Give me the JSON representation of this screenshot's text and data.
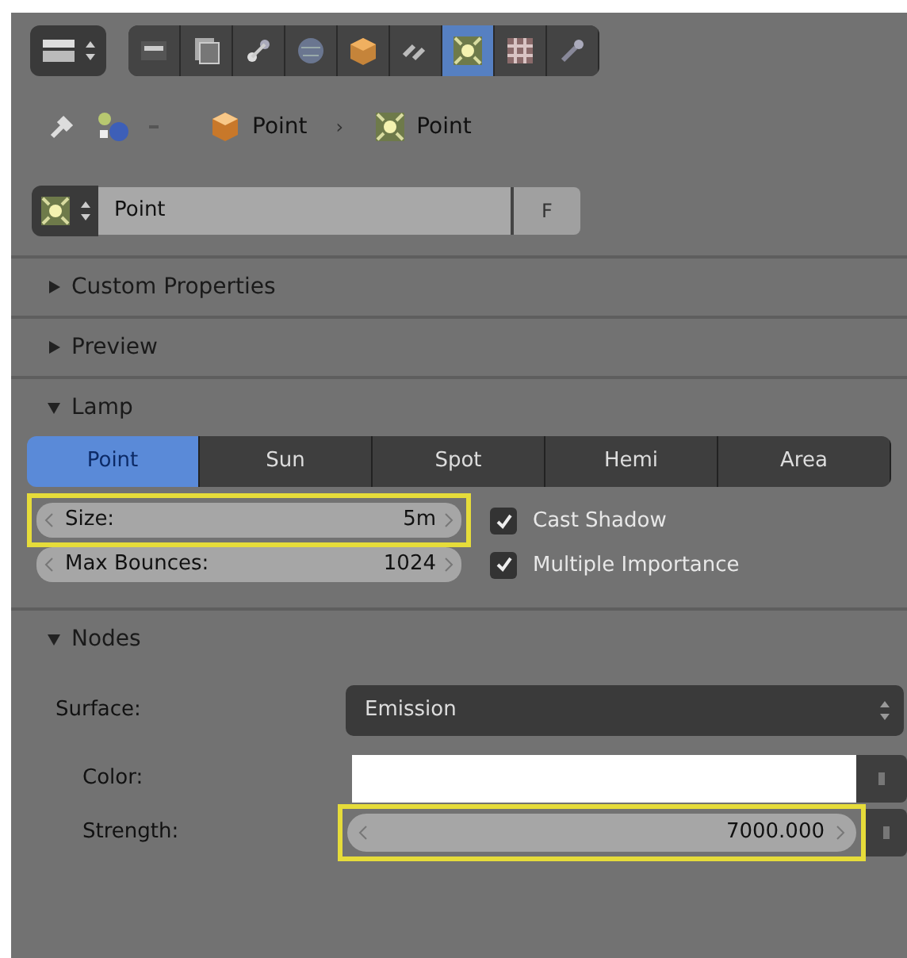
{
  "toolbar": {
    "buttons": [
      {
        "selected": false
      },
      {
        "selected": false
      },
      {
        "selected": false
      },
      {
        "selected": false
      },
      {
        "selected": false
      },
      {
        "selected": false
      },
      {
        "selected": true
      },
      {
        "selected": false
      },
      {
        "selected": false
      }
    ]
  },
  "breadcrumb": {
    "items": [
      "Point",
      "Point"
    ],
    "separator": "›"
  },
  "datablock": {
    "name": "Point",
    "fake_user": "F"
  },
  "panels": [
    {
      "title": "Custom Properties",
      "expanded": false
    },
    {
      "title": "Preview",
      "expanded": false
    }
  ],
  "lamp": {
    "title": "Lamp",
    "expanded": true,
    "tabs": [
      {
        "label": "Point",
        "selected": true
      },
      {
        "label": "Sun",
        "selected": false
      },
      {
        "label": "Spot",
        "selected": false
      },
      {
        "label": "Hemi",
        "selected": false
      },
      {
        "label": "Area",
        "selected": false
      }
    ],
    "fields": [
      {
        "label": "Size:",
        "value": "5m",
        "highlighted": true
      },
      {
        "label": "Max Bounces:",
        "value": "1024",
        "highlighted": false
      }
    ],
    "checkboxes": [
      {
        "label": "Cast Shadow",
        "checked": true
      },
      {
        "label": "Multiple Importance",
        "checked": true
      }
    ]
  },
  "nodes": {
    "title": "Nodes",
    "expanded": true,
    "surface": {
      "label": "Surface:",
      "value": "Emission"
    },
    "color": {
      "label": "Color:",
      "color": "#ffffff"
    },
    "strength": {
      "label": "Strength:",
      "value": "7000.000",
      "highlighted": true
    }
  }
}
